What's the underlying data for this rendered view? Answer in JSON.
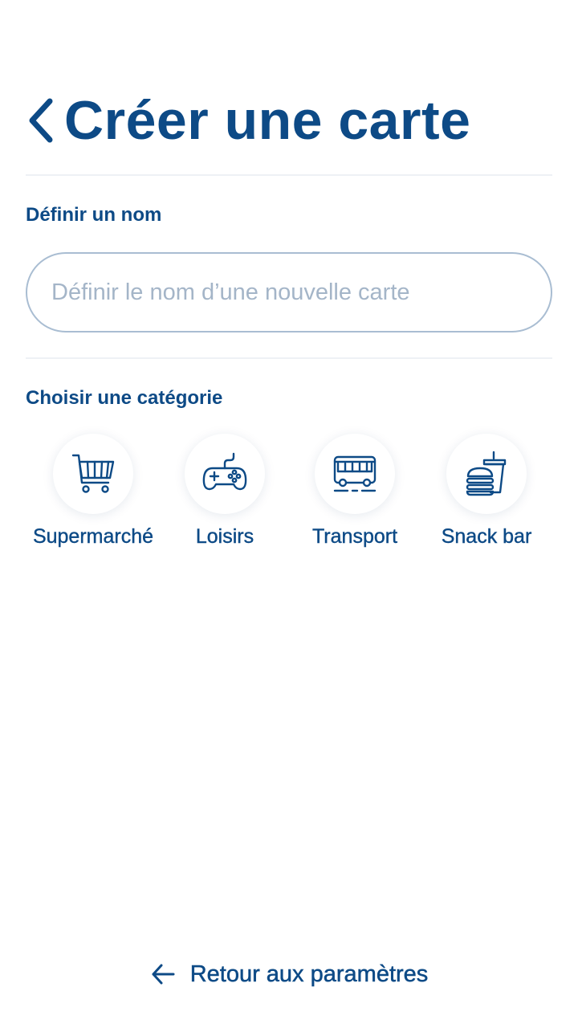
{
  "header": {
    "title": "Créer une carte",
    "back_icon": "chevron-left-icon"
  },
  "name_section": {
    "label": "Définir un nom",
    "input_value": "",
    "input_placeholder": "Définir le nom d’une nouvelle carte"
  },
  "category_section": {
    "label": "Choisir une catégorie",
    "items": [
      {
        "label": "Supermarché",
        "icon": "shopping-cart-icon"
      },
      {
        "label": "Loisirs",
        "icon": "gamepad-icon"
      },
      {
        "label": "Transport",
        "icon": "bus-icon"
      },
      {
        "label": "Snack bar",
        "icon": "burger-drink-icon"
      }
    ]
  },
  "footer": {
    "back_label": "Retour aux paramètres",
    "back_icon": "arrow-left-icon"
  },
  "colors": {
    "primary": "#0d4a86",
    "input_border": "#a9bdd2",
    "placeholder": "#a4b5c8",
    "divider": "#eef1f5",
    "background": "#ffffff"
  }
}
